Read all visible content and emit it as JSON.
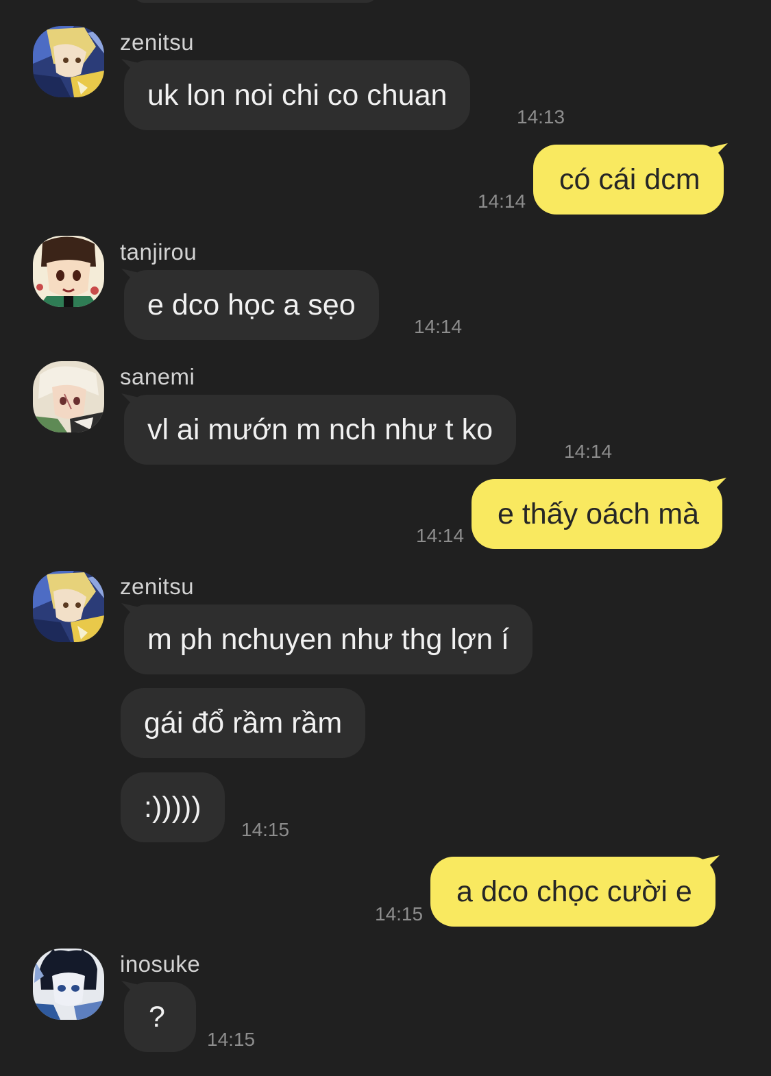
{
  "messages": [
    {
      "sender": "zenitsu",
      "avatar": "zenitsu-avatar",
      "text": "uk lon noi chi co chuan",
      "time": "14:13"
    },
    {
      "text": "có cái dcm",
      "time": "14:14"
    },
    {
      "sender": "tanjirou",
      "avatar": "tanjirou-avatar",
      "text": "e dco học a sẹo",
      "time": "14:14"
    },
    {
      "sender": "sanemi",
      "avatar": "sanemi-avatar",
      "text": "vl ai mướn m nch như t ko",
      "time": "14:14"
    },
    {
      "text": "e thấy oách mà",
      "time": "14:14"
    },
    {
      "sender": "zenitsu",
      "avatar": "zenitsu-avatar",
      "texts": [
        "m ph nchuyen như thg lợn í",
        "gái đổ rầm rầm",
        ":)))))"
      ],
      "time": "14:15"
    },
    {
      "text": "a dco chọc cười e",
      "time": "14:15"
    },
    {
      "sender": "inosuke",
      "avatar": "inosuke-avatar",
      "text": "?",
      "time": "14:15"
    }
  ],
  "colors": {
    "background": "#202020",
    "incoming_bubble": "#2e2e2e",
    "outgoing_bubble": "#f9e960",
    "timestamp": "#8d8d8d"
  }
}
